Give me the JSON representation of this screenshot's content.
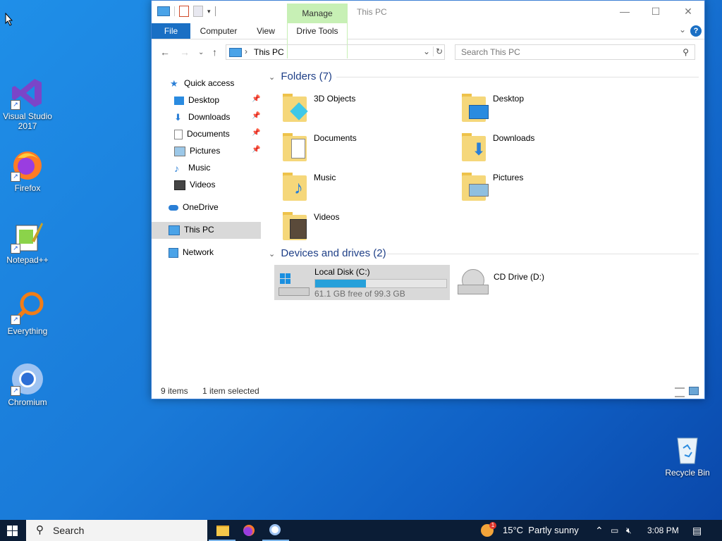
{
  "desktop": {
    "icons": [
      {
        "label": "Visual Studio 2017"
      },
      {
        "label": "Firefox"
      },
      {
        "label": "Notepad++"
      },
      {
        "label": "Everything"
      },
      {
        "label": "Chromium"
      },
      {
        "label": "Recycle Bin"
      }
    ]
  },
  "window": {
    "title": "This PC",
    "manage_tab": "Manage",
    "ribbon_tabs": [
      "File",
      "Computer",
      "View",
      "Drive Tools"
    ],
    "help": "?",
    "address": {
      "location": "This PC"
    },
    "search_placeholder": "Search This PC",
    "nav": {
      "quick_access": "Quick access",
      "items": [
        "Desktop",
        "Downloads",
        "Documents",
        "Pictures",
        "Music",
        "Videos"
      ],
      "onedrive": "OneDrive",
      "this_pc": "This PC",
      "network": "Network"
    },
    "folders": {
      "header": "Folders (7)",
      "items": [
        "3D Objects",
        "Desktop",
        "Documents",
        "Downloads",
        "Music",
        "Pictures",
        "Videos"
      ]
    },
    "devices": {
      "header": "Devices and drives (2)",
      "local_disk": {
        "name": "Local Disk (C:)",
        "free": "61.1 GB free of 99.3 GB",
        "used_fraction": 0.385
      },
      "cd_drive": {
        "name": "CD Drive (D:)"
      }
    },
    "status": {
      "items": "9 items",
      "selected": "1 item selected"
    }
  },
  "taskbar": {
    "search": "Search",
    "weather": "15°C  Partly sunny",
    "weather_badge": "1",
    "time": "3:08 PM"
  },
  "colors": {
    "accent": "#1a6fc4",
    "selection": "#cce8ff",
    "manage_tab": "#c7f0b5",
    "folder_header": "#1e3f87"
  }
}
